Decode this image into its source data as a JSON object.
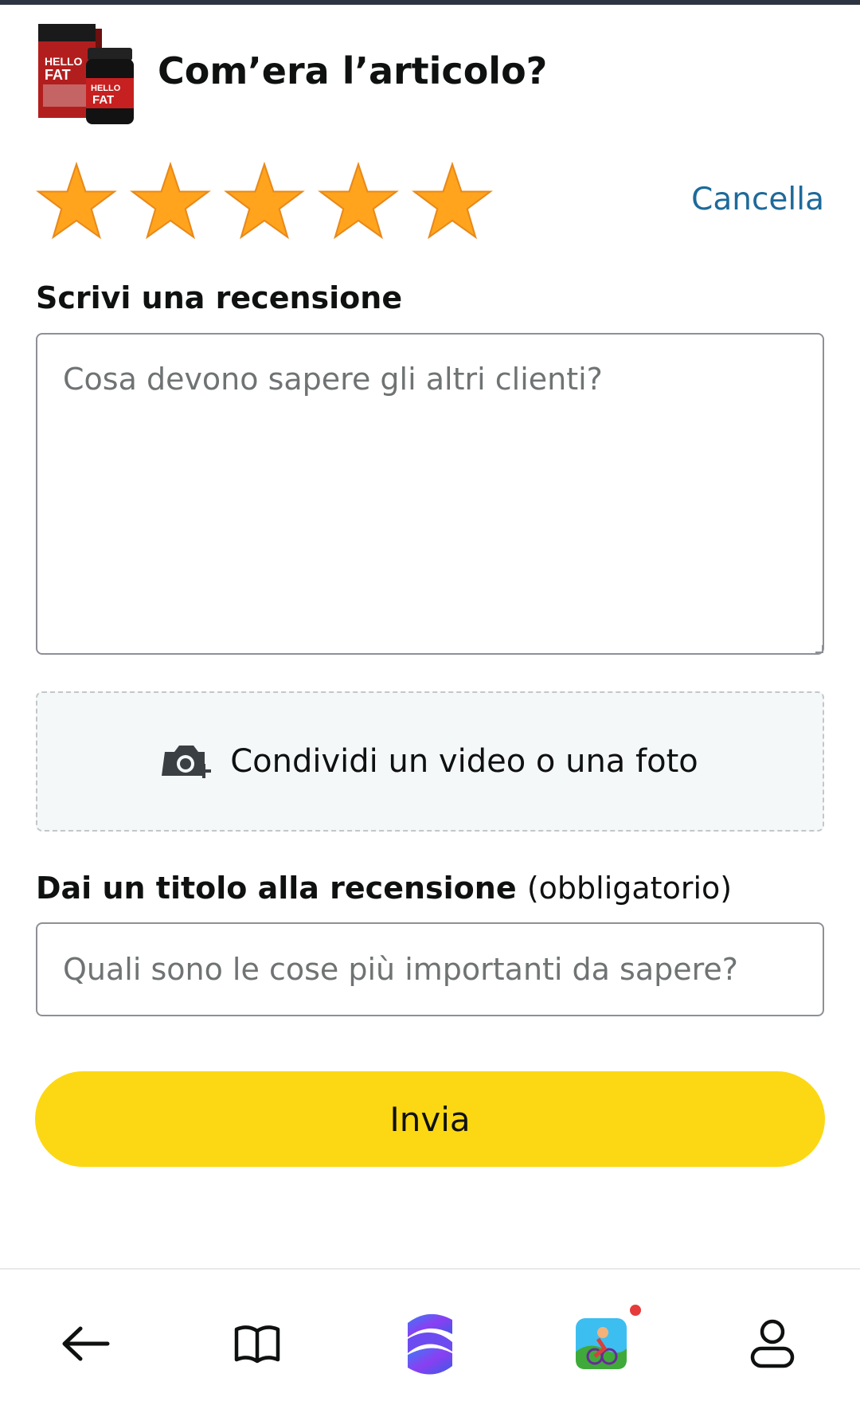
{
  "header": {
    "title": "Com’era l’articolo?",
    "product_image_text": "HELLO FAT"
  },
  "rating": {
    "stars_selected": 5,
    "stars_total": 5,
    "clear_label": "Cancella",
    "star_color": "#ffa41c"
  },
  "review": {
    "label": "Scrivi una recensione",
    "placeholder": "Cosa devono sapere gli altri clienti?",
    "value": ""
  },
  "media": {
    "label": "Condividi un video o una foto",
    "icon": "camera-plus-icon"
  },
  "title_field": {
    "label": "Dai un titolo alla recensione",
    "label_suffix": "(obbligatorio)",
    "placeholder": "Quali sono le cose più importanti da sapere?",
    "value": ""
  },
  "submit": {
    "label": "Invia",
    "color": "#fcd814"
  },
  "bottom_nav": {
    "items": [
      {
        "icon": "back-arrow-icon"
      },
      {
        "icon": "book-icon"
      },
      {
        "icon": "assistant-logo-icon"
      },
      {
        "icon": "game-app-icon",
        "notification": true
      },
      {
        "icon": "account-icon"
      }
    ],
    "notification_color": "#e53b3b"
  }
}
